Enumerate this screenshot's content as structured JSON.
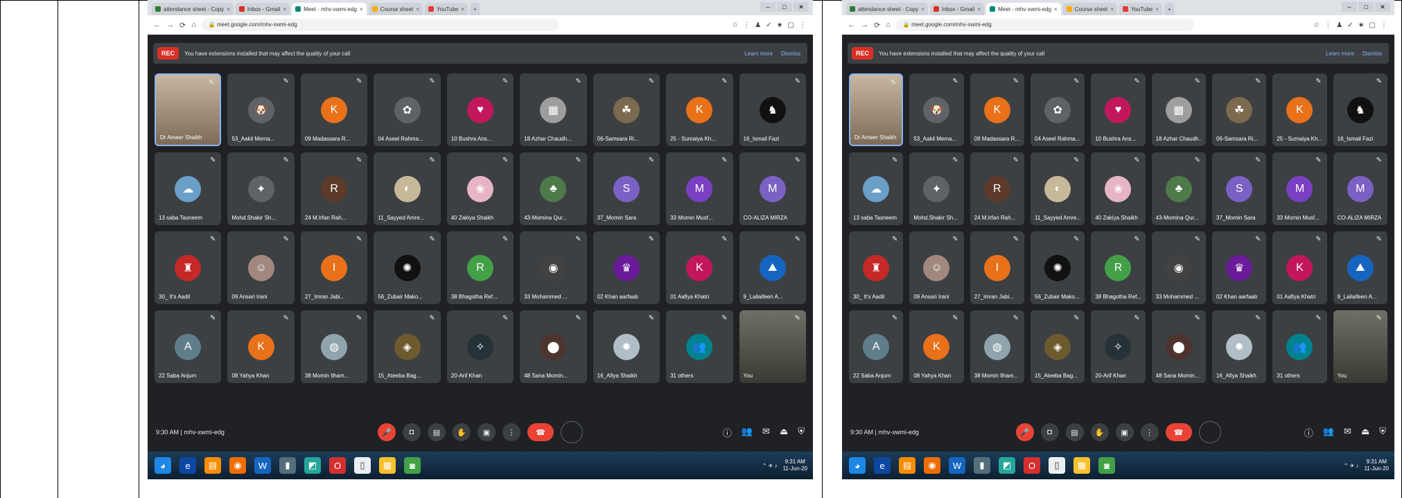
{
  "browser": {
    "tabs": [
      {
        "label": "attendance sheet - Copy",
        "favicon": "#2e7d32",
        "close": "×"
      },
      {
        "label": "Inbox - Gmail",
        "favicon": "#d93025",
        "close": "×"
      },
      {
        "label": "Meet - mhv-xwmi-edg",
        "favicon": "#00897b",
        "close": "×",
        "active": true
      },
      {
        "label": "Course sheet",
        "favicon": "#f9ab00",
        "close": "×"
      },
      {
        "label": "YouTube",
        "favicon": "#e53935",
        "close": "×"
      }
    ],
    "new_tab": "+",
    "window_buttons": [
      "–",
      "□",
      "✕"
    ],
    "nav": [
      "←",
      "→",
      "⟳",
      "⌂"
    ],
    "lock": "🔒",
    "url": "meet.google.com/mhv-xwmi-edg",
    "extensions": [
      "☆",
      "⋮",
      "♟",
      "✓",
      "★",
      "▢",
      "⋮"
    ]
  },
  "banner": {
    "rec_label": "REC",
    "message": "You have extensions installed that may affect the quality of your call",
    "learn_more": "Learn more",
    "dismiss": "Dismiss"
  },
  "participants": [
    {
      "name": "Dr Ameer Shaikh",
      "initial": "",
      "color": "",
      "kind": "self"
    },
    {
      "name": "53_Aakil Mema...",
      "initial": "🐶",
      "color": "#5f6368"
    },
    {
      "name": "09 Madassara R...",
      "initial": "K",
      "color": "#e8711a"
    },
    {
      "name": "04 Aseel Rahma...",
      "initial": "✿",
      "color": "#5f6368"
    },
    {
      "name": "10 Bushra Ans...",
      "initial": "♥",
      "color": "#c2185b"
    },
    {
      "name": "18 Azhar Chaudh...",
      "initial": "▦",
      "color": "#9e9e9e"
    },
    {
      "name": "06-Samsara Ri...",
      "initial": "☘",
      "color": "#7c6a4e"
    },
    {
      "name": "25 - Sumaiya Kh...",
      "initial": "K",
      "color": "#e8711a"
    },
    {
      "name": "16_Ismail Fazi",
      "initial": "♞",
      "color": "#111111"
    },
    {
      "name": "13 saba Tasneem",
      "initial": "☁",
      "color": "#6a9fc7"
    },
    {
      "name": "Mohd.Shakir Sh...",
      "initial": "✦",
      "color": "#5f6368"
    },
    {
      "name": "24 M.Irfan Rah...",
      "initial": "R",
      "color": "#5d3a2a"
    },
    {
      "name": "11_Sayyed Amre...",
      "initial": "◐",
      "color": "#c8b89a"
    },
    {
      "name": "40 Zakiya Shaikh",
      "initial": "❀",
      "color": "#e6b4c4"
    },
    {
      "name": "43-Momina Qur...",
      "initial": "♣",
      "color": "#4e7a4a"
    },
    {
      "name": "37_Momin Sara",
      "initial": "S",
      "color": "#7b61c4"
    },
    {
      "name": "33 Momin Musf...",
      "initial": "M",
      "color": "#7b3fc4"
    },
    {
      "name": "CO-ALIZA MIRZA",
      "initial": "M",
      "color": "#7b61c4"
    },
    {
      "name": "30_ It's Aadil",
      "initial": "♜",
      "color": "#c62828"
    },
    {
      "name": "09 Ansari Irani",
      "initial": "☺",
      "color": "#a1887f"
    },
    {
      "name": "27_Imran Jabi...",
      "initial": "I",
      "color": "#e8711a"
    },
    {
      "name": "56_Zubair Mako...",
      "initial": "✺",
      "color": "#111111"
    },
    {
      "name": "38 Bhagotha Ref...",
      "initial": "R",
      "color": "#43a047"
    },
    {
      "name": "33 Mohammed ...",
      "initial": "◉",
      "color": "#424242"
    },
    {
      "name": "02 Khan aarfaab",
      "initial": "♛",
      "color": "#6a1b9a"
    },
    {
      "name": "01 Aafiya Khatri",
      "initial": "K",
      "color": "#c2185b"
    },
    {
      "name": "9_Lailaifeen A...",
      "initial": "⛰",
      "color": "#1565c0"
    },
    {
      "name": "22 Saba Anjum",
      "initial": "A",
      "color": "#607d8b"
    },
    {
      "name": "08 Yahya Khan",
      "initial": "K",
      "color": "#e8711a"
    },
    {
      "name": "38 Momin Ilham...",
      "initial": "◍",
      "color": "#90a4ae"
    },
    {
      "name": "15_Ateeba Bag...",
      "initial": "◈",
      "color": "#6d5b2e"
    },
    {
      "name": "20-Arif Khan",
      "initial": "✧",
      "color": "#263238"
    },
    {
      "name": "48 Sana Momin...",
      "initial": "⬤",
      "color": "#4e342e"
    },
    {
      "name": "16_Afiya Shaikh",
      "initial": "✹",
      "color": "#b0bec5"
    },
    {
      "name": "31 others",
      "initial": "👥",
      "color": "#00838f"
    },
    {
      "name": "You",
      "initial": "",
      "color": "",
      "kind": "video"
    }
  ],
  "tile_mic": "✎",
  "controls": {
    "meeting_info": "9:30 AM | mhv-xwmi-edg",
    "mic_icon": "🎤",
    "cam_icon": "◘",
    "cc_icon": "▤",
    "hand_icon": "✋",
    "present_icon": "▣",
    "more_icon": "⋮",
    "end_icon": "☎",
    "info_icon": "ⓘ",
    "people_icon": "👥",
    "chat_icon": "✉",
    "activities_icon": "⏏",
    "host_icon": "⛨"
  },
  "taskbar": {
    "apps": [
      {
        "glyph": "◕",
        "color": "#1e88e5"
      },
      {
        "glyph": "e",
        "color": "#0d47a1"
      },
      {
        "glyph": "▤",
        "color": "#fb8c00"
      },
      {
        "glyph": "◉",
        "color": "#ef6c00"
      },
      {
        "glyph": "W",
        "color": "#1565c0"
      },
      {
        "glyph": "▮",
        "color": "#546e7a"
      },
      {
        "glyph": "◩",
        "color": "#26a69a"
      },
      {
        "glyph": "O",
        "color": "#d32f2f"
      },
      {
        "glyph": "▯",
        "color": "#eceff1"
      },
      {
        "glyph": "▦",
        "color": "#fbc02d"
      },
      {
        "glyph": "◙",
        "color": "#43a047"
      }
    ],
    "tray": "⌃ ✈ ♪",
    "time": "9:31 AM",
    "date": "11-Jun-20"
  }
}
